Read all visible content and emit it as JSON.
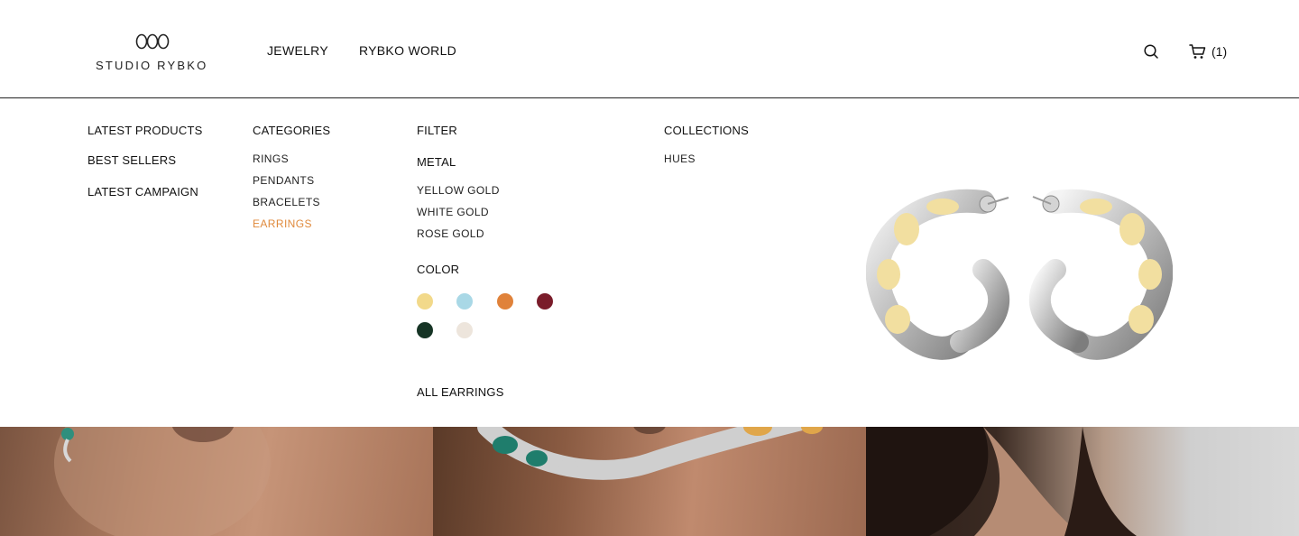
{
  "header": {
    "logo_text": "STUDIO RYBKO",
    "nav": [
      {
        "label": "JEWELRY"
      },
      {
        "label": "RYBKO WORLD"
      }
    ],
    "cart_count": "(1)"
  },
  "menu": {
    "featured": [
      {
        "label": "LATEST PRODUCTS"
      },
      {
        "label": "BEST SELLERS"
      },
      {
        "label": "LATEST CAMPAIGN"
      }
    ],
    "categories": {
      "title": "CATEGORIES",
      "items": [
        {
          "label": "RINGS"
        },
        {
          "label": "PENDANTS"
        },
        {
          "label": "BRACELETS"
        },
        {
          "label": "EARRINGS",
          "active": true
        }
      ]
    },
    "filter": {
      "title": "FILTER",
      "metal_title": "METAL",
      "metals": [
        {
          "label": "YELLOW GOLD"
        },
        {
          "label": "WHITE GOLD"
        },
        {
          "label": "ROSE GOLD"
        }
      ],
      "color_title": "COLOR",
      "colors": [
        "#f2d98a",
        "#a9d8e6",
        "#e0823a",
        "#7a1c2a",
        "#163425",
        "#ede5dc"
      ],
      "all_link": "ALL EARRINGS"
    },
    "collections": {
      "title": "COLLECTIONS",
      "items": [
        {
          "label": "HUES"
        }
      ]
    }
  },
  "colors": {
    "accent": "#e08a3c",
    "text": "#111111",
    "border": "#222222"
  }
}
